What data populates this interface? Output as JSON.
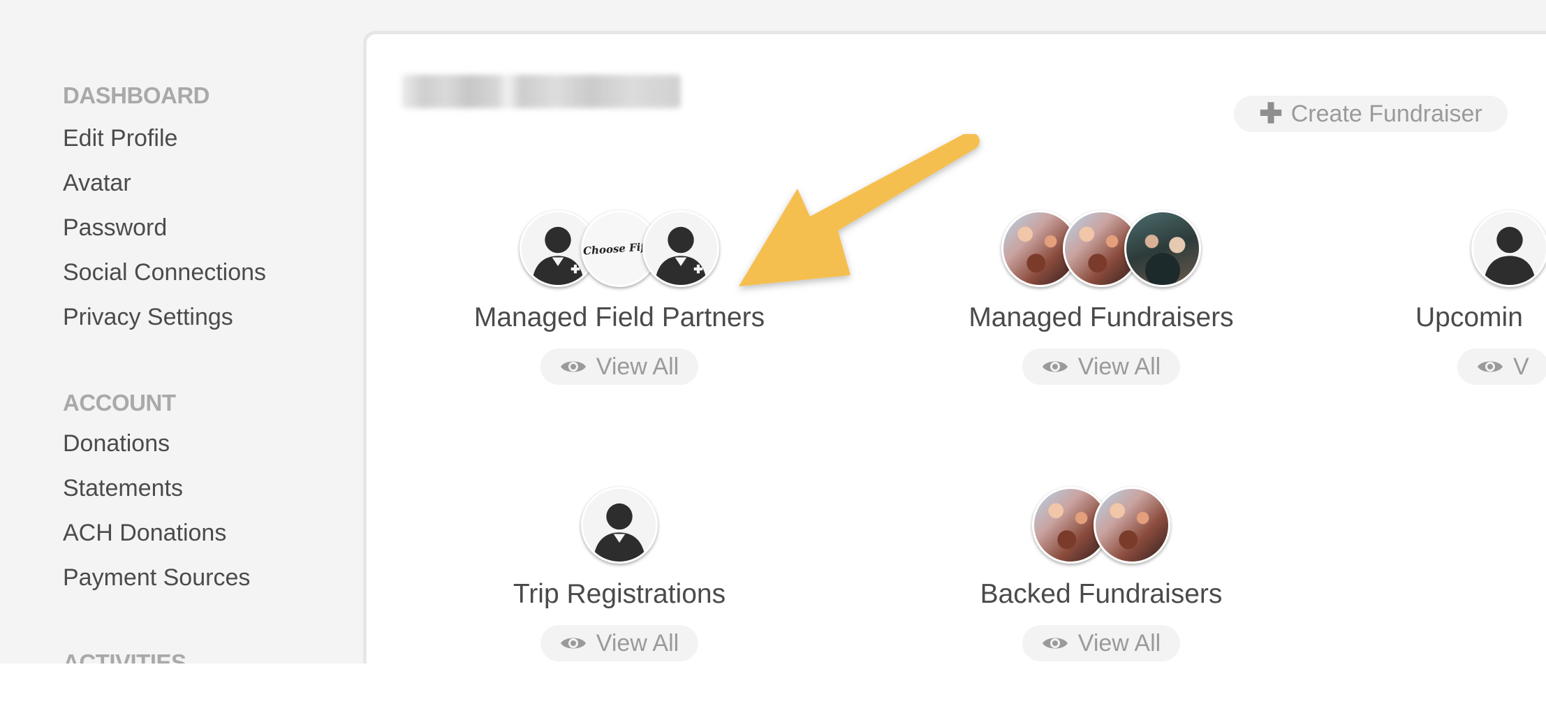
{
  "sidebar": {
    "sections": [
      {
        "heading": "DASHBOARD",
        "items": [
          "Edit Profile",
          "Avatar",
          "Password",
          "Social Connections",
          "Privacy Settings"
        ]
      },
      {
        "heading": "ACCOUNT",
        "items": [
          "Donations",
          "Statements",
          "ACH Donations",
          "Payment Sources"
        ]
      },
      {
        "heading": "ACTIVITIES",
        "items": []
      }
    ]
  },
  "main": {
    "create_button": {
      "label": "Create Fundraiser",
      "icon": "plus-icon"
    },
    "groups": [
      {
        "title": "Managed Field Partners",
        "view_label": "View All",
        "avatars": [
          "person-icon",
          "choose-fifty-logo",
          "person-icon"
        ]
      },
      {
        "title": "Managed Fundraisers",
        "view_label": "View All",
        "avatars": [
          "crowd-photo",
          "crowd-photo",
          "group-photo"
        ]
      },
      {
        "title": "Upcomin",
        "view_label": "V",
        "avatars": [
          "person-icon"
        ]
      },
      {
        "title": "Trip Registrations",
        "view_label": "View All",
        "avatars": [
          "person-icon"
        ]
      },
      {
        "title": "Backed Fundraisers",
        "view_label": "View All",
        "avatars": [
          "crowd-photo",
          "crowd-photo"
        ]
      }
    ],
    "logo_text": "Choose Fifty"
  },
  "colors": {
    "page_bg": "#f4f4f4",
    "heading": "#a9a9a9",
    "text": "#4b4b4b",
    "button_bg": "#f3f3f3",
    "arrow": "#f5bf4f"
  }
}
